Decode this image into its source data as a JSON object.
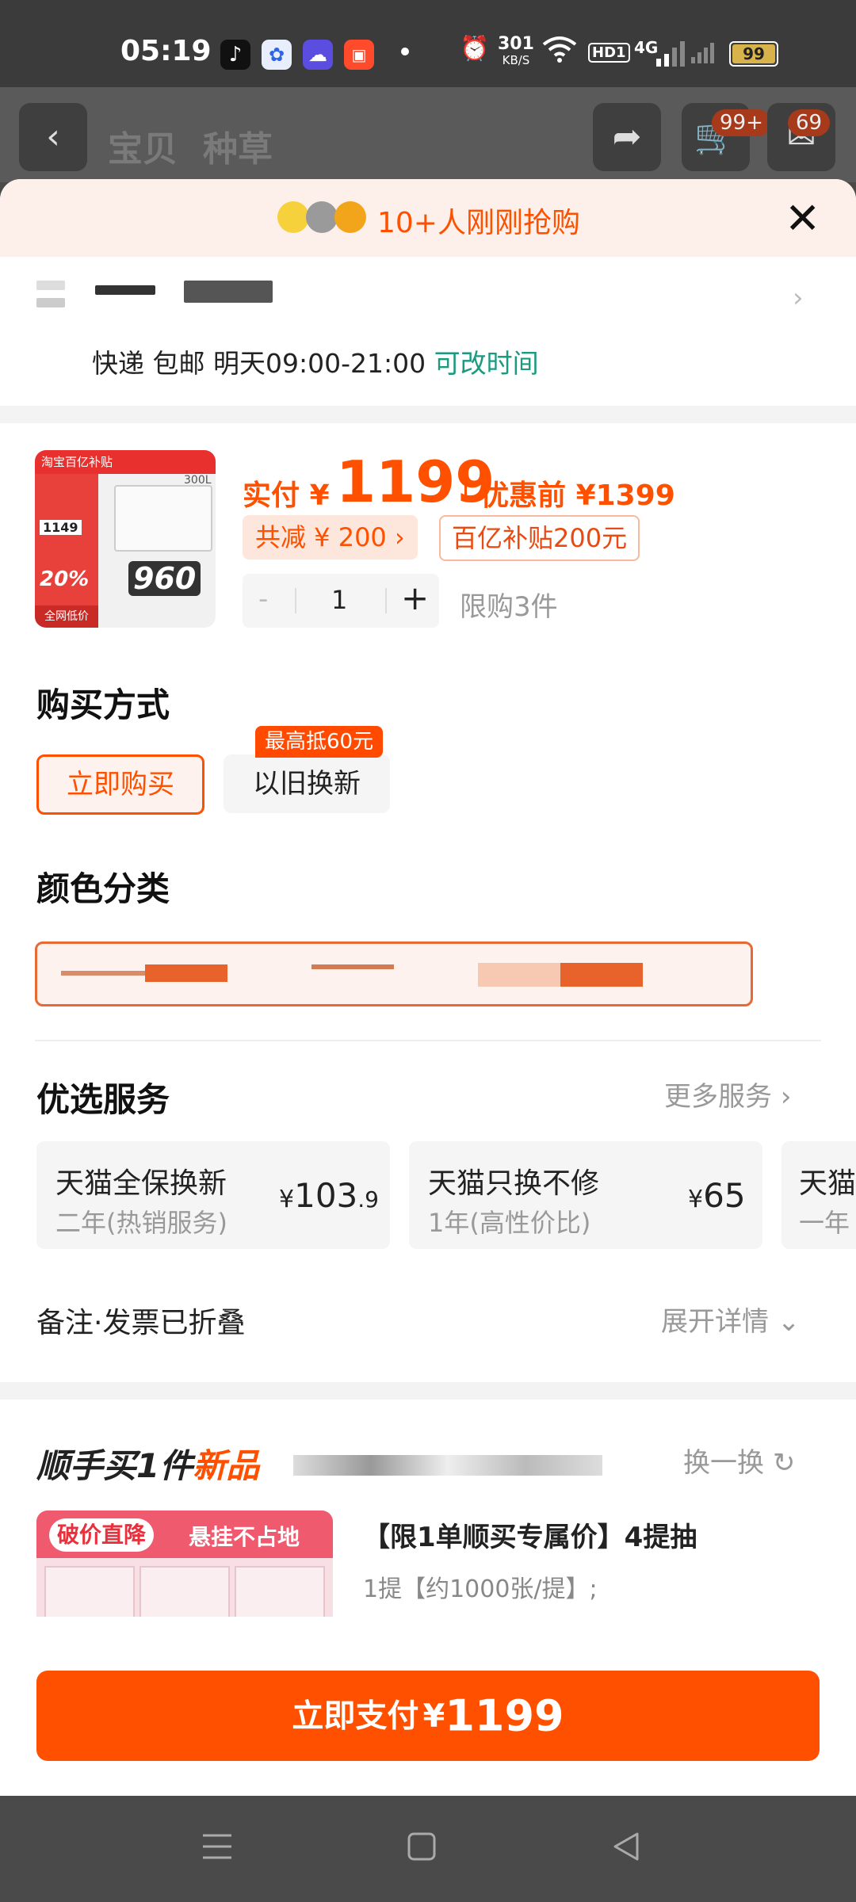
{
  "status_bar": {
    "time": "05:19",
    "net_speed": "301",
    "net_speed_unit": "KB/S",
    "hd_label": "HD1",
    "net_type": "4G",
    "battery": "99"
  },
  "background_header": {
    "back_icon": "chevron-left-icon",
    "tabs": [
      "宝贝",
      "种草"
    ],
    "cart_badge": "99+",
    "msg_badge": "69"
  },
  "banner": {
    "text": "10+人刚刚抢购",
    "close_icon": "close-icon"
  },
  "address": {
    "delivery_text": "快递 包邮 明天09:00-21:00",
    "change_time_link": "可改时间"
  },
  "product": {
    "price_label": "实付",
    "currency": "¥",
    "price": "1199",
    "pre_discount_label": "优惠前",
    "pre_discount_price": "¥1399",
    "total_discount_tag": "共减 ¥ 200",
    "subsidy_tag": "百亿补贴200元",
    "qty_minus": "-",
    "quantity": "1",
    "qty_plus": "+",
    "limit_text": "限购3件",
    "thumb": {
      "badge": "淘宝百亿补贴",
      "capacity": "300L",
      "price_small": "1149",
      "big_number": "960",
      "percent": "20%",
      "footer": "全网低价"
    }
  },
  "purchase_method": {
    "title": "购买方式",
    "options": [
      "立即购买",
      "以旧换新"
    ],
    "selected_index": 0,
    "trade_in_badge": "最高抵60元"
  },
  "color": {
    "title": "颜色分类"
  },
  "services": {
    "title": "优选服务",
    "more_label": "更多服务",
    "items": [
      {
        "title": "天猫全保换新",
        "subtitle": "二年(热销服务)",
        "currency": "¥",
        "price_int": "103",
        "price_dec": ".9"
      },
      {
        "title": "天猫只换不修",
        "subtitle": "1年(高性价比)",
        "currency": "¥",
        "price_int": "65",
        "price_dec": ""
      },
      {
        "title": "天猫",
        "subtitle": "一年",
        "currency": "",
        "price_int": "",
        "price_dec": ""
      }
    ]
  },
  "note": {
    "label": "备注·发票已折叠",
    "expand_label": "展开详情"
  },
  "bundle": {
    "title_prefix": "顺手买1件",
    "title_new": "新品",
    "swap_label": "换一换",
    "img_tag1": "破价直降",
    "img_tag2": "悬挂不占地",
    "item_title": "【限1单顺买专属价】4提抽",
    "item_desc": "1提【约1000张/提】;"
  },
  "pay": {
    "label": "立即支付",
    "currency": "¥",
    "amount": "1199"
  },
  "colors": {
    "accent": "#ff5000",
    "green": "#1a9a7f"
  }
}
